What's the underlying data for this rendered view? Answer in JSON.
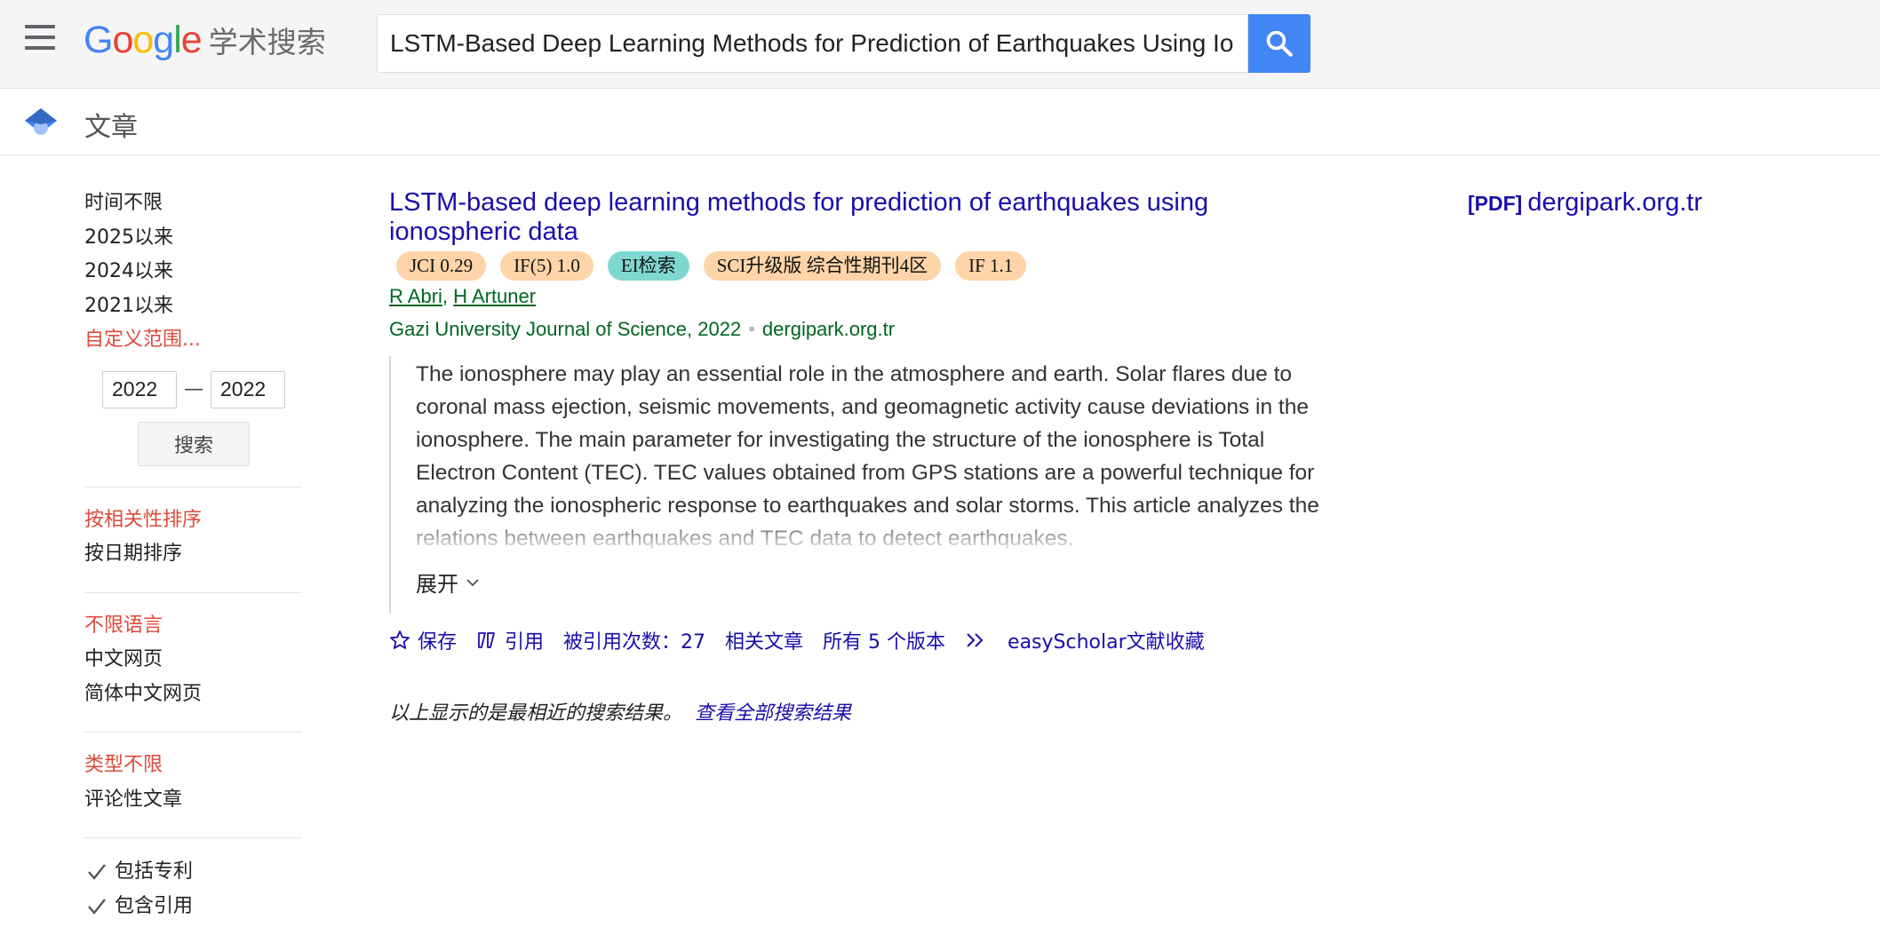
{
  "header": {
    "logo_letters": [
      {
        "ch": "G",
        "color": "#4285F4"
      },
      {
        "ch": "o",
        "color": "#EA4335"
      },
      {
        "ch": "o",
        "color": "#FBBC05"
      },
      {
        "ch": "g",
        "color": "#4285F4"
      },
      {
        "ch": "l",
        "color": "#34A853"
      },
      {
        "ch": "e",
        "color": "#EA4335"
      }
    ],
    "logo_suffix": "学术搜索",
    "search_value": "LSTM-Based Deep Learning Methods for Prediction of Earthquakes Using Ionospheric Data",
    "menu_icon": "hamburger-menu-icon",
    "search_icon": "search-icon"
  },
  "subheader": {
    "title": "文章",
    "icon": "scholar-cap-icon"
  },
  "sidebar": {
    "time_filters": [
      "时间不限",
      "2025以来",
      "2024以来",
      "2021以来"
    ],
    "custom_range": "自定义范围...",
    "from_year": "2022",
    "dash": "—",
    "to_year": "2022",
    "search_btn": "搜索",
    "sort_options": [
      "按相关性排序",
      "按日期排序"
    ],
    "language_options": [
      "不限语言",
      "中文网页",
      "简体中文网页"
    ],
    "type_options": [
      "类型不限",
      "评论性文章"
    ],
    "checkboxes": [
      "包括专利",
      "包含引用"
    ]
  },
  "result": {
    "title": "LSTM-based deep learning methods for prediction of earthquakes using ionospheric data",
    "badges": [
      {
        "label": "JCI 0.29",
        "style": "orange"
      },
      {
        "label": "IF(5) 1.0",
        "style": "orange"
      },
      {
        "label": "EI检索",
        "style": "teal"
      },
      {
        "label": "SCI升级版 综合性期刊4区",
        "style": "orange"
      },
      {
        "label": "IF 1.1",
        "style": "orange"
      }
    ],
    "authors": [
      "R Abri",
      "H Artuner"
    ],
    "author_sep": ", ",
    "source": "Gazi University Journal of Science, 2022",
    "source_sep": "•",
    "source_domain": "dergipark.org.tr",
    "abstract": "The ionosphere may play an essential role in the atmosphere and earth. Solar flares due to coronal mass ejection, seismic movements, and geomagnetic activity cause deviations in the ionosphere. The main parameter for investigating the structure of the ionosphere is Total Electron Content (TEC). TEC values obtained from GPS stations are a powerful technique for analyzing the ionospheric response to earthquakes and solar storms. This article analyzes the relations between earthquakes and TEC data to detect earthquakes.",
    "expand_label": "展开",
    "actions": {
      "save": "保存",
      "cite": "引用",
      "cited_by": "被引用次数：27",
      "related": "相关文章",
      "versions": "所有 5 个版本",
      "easyscholar": "easyScholar文献收藏"
    }
  },
  "footer": {
    "note": "以上显示的是最相近的搜索结果。",
    "link": "查看全部搜索结果"
  },
  "pdf": {
    "tag": "[PDF]",
    "domain": "dergipark.org.tr"
  },
  "colors": {
    "link_blue": "#1a0dab",
    "green": "#006621",
    "active_red": "#dd4b39",
    "search_button_blue": "#4285f4",
    "badge_orange": "#ffd4a8",
    "badge_teal": "#7fd8cf"
  }
}
